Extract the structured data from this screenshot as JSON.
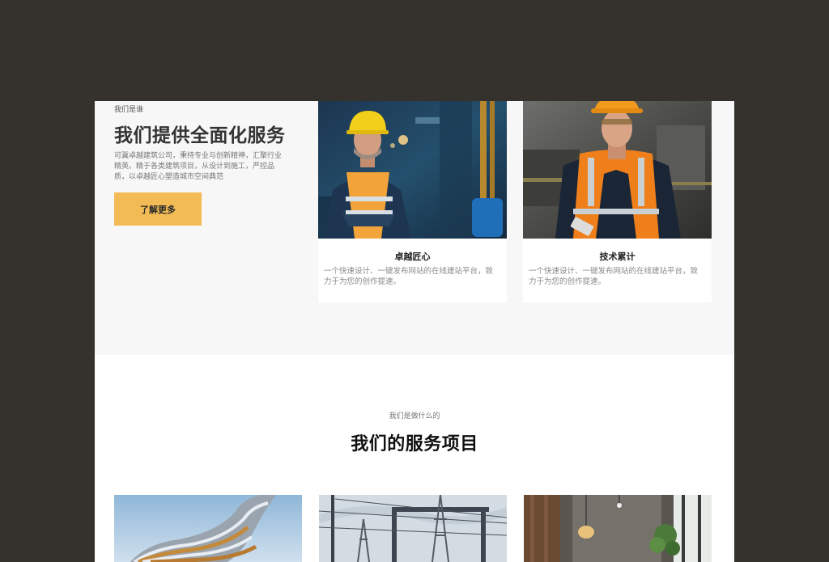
{
  "about": {
    "eyebrow": "我们是谁",
    "title": "我们提供全面化服务",
    "description": "可冀卓越建筑公司，秉持专业与创新精神，汇聚行业精英。精于各类建筑项目，从设计到施工，严控品质，以卓越匠心塑造城市空间典范",
    "button_label": "了解更多"
  },
  "cards": [
    {
      "title": "卓越匠心",
      "description": "一个快速设计、一键发布网站的在线建站平台，致力于为您的创作提速。"
    },
    {
      "title": "技术累计",
      "description": "一个快速设计、一键发布网站的在线建站平台，致力于为您的创作提速。"
    }
  ],
  "services": {
    "eyebrow": "我们是做什么的",
    "title": "我们的服务项目"
  },
  "colors": {
    "backdrop": "#35312d",
    "accent": "#f3bb55",
    "section_bg": "#f7f7f7"
  }
}
